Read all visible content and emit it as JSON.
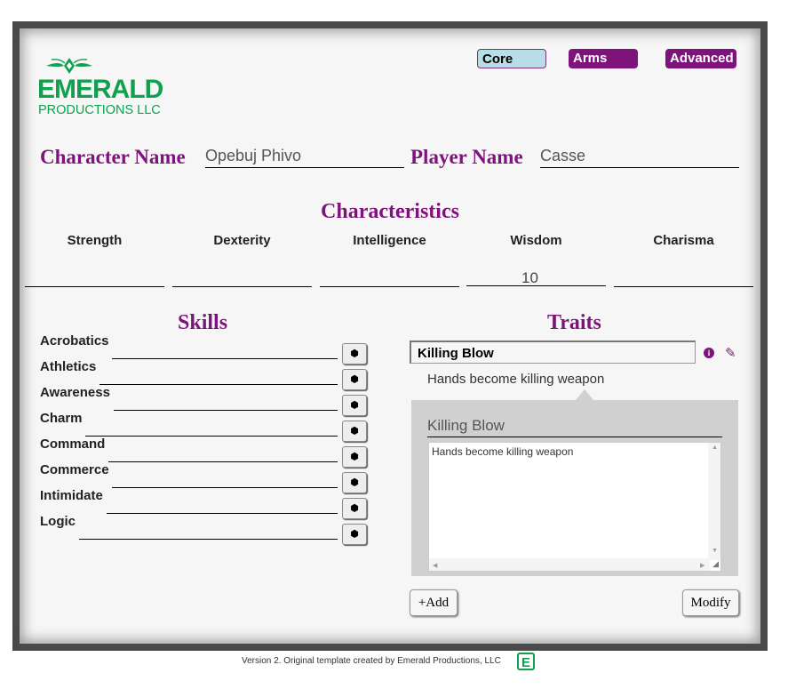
{
  "tabs": [
    {
      "label": "Core"
    },
    {
      "label": "Arms"
    },
    {
      "label": "Advanced"
    }
  ],
  "logo": {
    "line1": "EMERALD",
    "line2": "PRODUCTIONS LLC",
    "color": "#11a04f"
  },
  "character": {
    "name_label": "Character Name",
    "name_value": "Opebuj Phivo",
    "player_label": "Player Name",
    "player_value": "Casse"
  },
  "characteristics": {
    "title": "Characteristics",
    "items": [
      {
        "label": "Strength",
        "value": ""
      },
      {
        "label": "Dexterity",
        "value": ""
      },
      {
        "label": "Intelligence",
        "value": ""
      },
      {
        "label": "Wisdom",
        "value": "10"
      },
      {
        "label": "Charisma",
        "value": ""
      }
    ]
  },
  "skills": {
    "title": "Skills",
    "items": [
      {
        "label": "Acrobatics",
        "value": ""
      },
      {
        "label": "Athletics",
        "value": ""
      },
      {
        "label": "Awareness",
        "value": ""
      },
      {
        "label": "Charm",
        "value": ""
      },
      {
        "label": "Command",
        "value": ""
      },
      {
        "label": "Commerce",
        "value": ""
      },
      {
        "label": "Intimidate",
        "value": ""
      },
      {
        "label": "Logic",
        "value": ""
      }
    ]
  },
  "traits": {
    "title": "Traits",
    "selected": "Killing Blow",
    "selected_desc": "Hands become killing weapon",
    "edit_name": "Killing Blow",
    "edit_text": "Hands become killing weapon",
    "add_label": "+Add",
    "modify_label": "Modify"
  },
  "footer": {
    "text": "Version 2. Original template created by Emerald Productions, LLC",
    "logo_letter": "E"
  },
  "colors": {
    "accent": "#7d137b",
    "brand": "#11a04f"
  }
}
